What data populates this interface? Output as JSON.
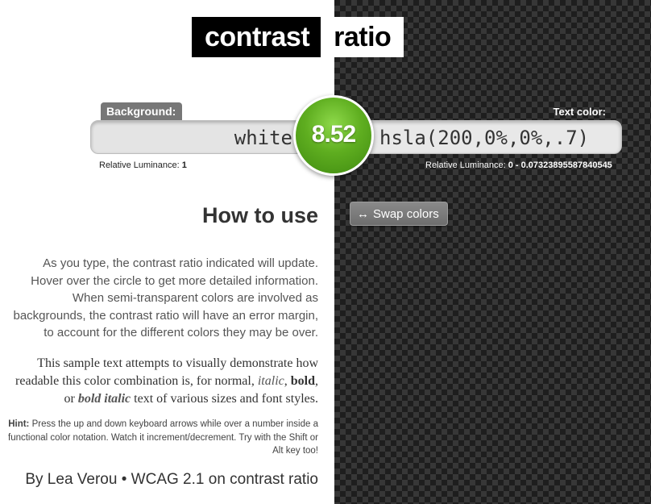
{
  "logo": {
    "part1": "contrast",
    "part2": "ratio"
  },
  "background": {
    "label": "Background:",
    "value": "white",
    "luminance_label": "Relative Luminance:",
    "luminance_value": "1"
  },
  "foreground": {
    "label": "Text color:",
    "value": "hsla(200,0%,0%,.7)",
    "luminance_label": "Relative Luminance:",
    "luminance_value": "0 - 0.07323895587840545"
  },
  "ratio": "8.52",
  "swap": {
    "icon": "↔",
    "label": "Swap colors"
  },
  "howto": {
    "title": "How to use",
    "paragraph1": "As you type, the contrast ratio indicated will update. Hover over the circle to get more detailed information. When semi-transparent colors are involved as backgrounds, the contrast ratio will have an error margin, to account for the different colors they may be over.",
    "sample": {
      "part1": "This sample text attempts to visually demonstrate how readable this color combination is, for normal, ",
      "italic": "italic",
      "sep1": ", ",
      "bold": "bold",
      "sep2": ", or ",
      "bold_italic": "bold italic",
      "part2": " text of various sizes and font styles."
    },
    "hint_label": "Hint:",
    "hint_text": " Press the up and down keyboard arrows while over a number inside a functional color notation. Watch it increment/decrement. Try with the Shift or Alt key too!"
  },
  "footer": {
    "author": "By Lea Verou",
    "separator": " • ",
    "link": "WCAG 2.1 on contrast ratio"
  },
  "colors": {
    "ratio_circle": "#5fae20",
    "label_bg": "#777777",
    "checker_light": "#555555",
    "checker_dark": "#2e2e2e"
  }
}
